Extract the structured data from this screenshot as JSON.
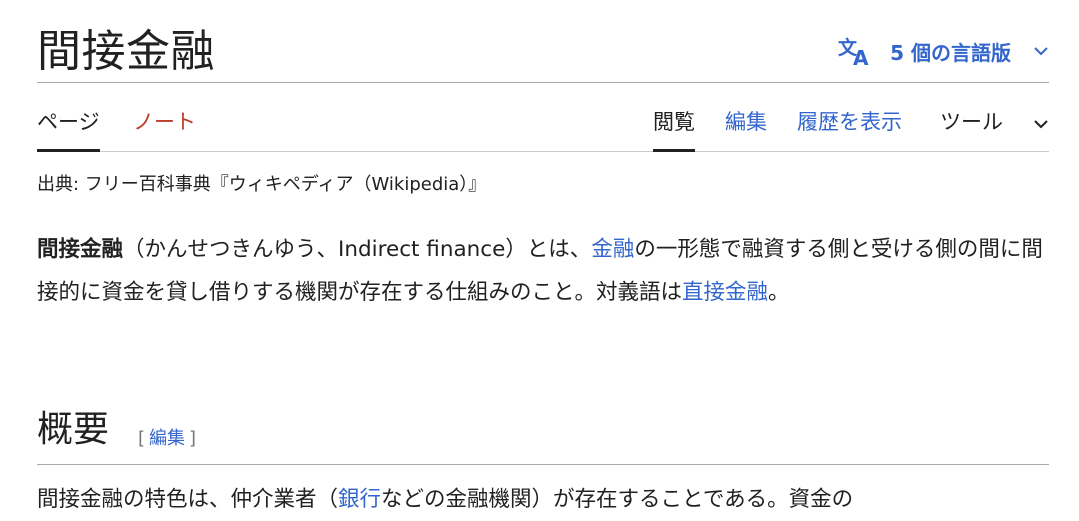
{
  "article": {
    "title": "間接金融"
  },
  "language_button": {
    "label": "5 個の言語版",
    "icon": "translate-icon",
    "chevron": "chevron-down-icon",
    "color": "#3366cc"
  },
  "tabs": {
    "page": "ページ",
    "talk": "ノート",
    "read": "閲覧",
    "edit": "編集",
    "history": "履歴を表示",
    "tools": "ツール"
  },
  "from_line": "出典: フリー百科事典『ウィキペディア（Wikipedia）』",
  "intro": {
    "term": "間接金融",
    "text1": "（かんせつきんゆう、Indirect finance）とは、",
    "link1": "金融",
    "text2": "の一形態で融資する側と受ける側の間に間接的に資金を貸し借りする機関が存在する仕組みのこと。対義語は",
    "link2": "直接金融",
    "text3": "。"
  },
  "section": {
    "title": "概要",
    "edit_open": "[",
    "edit_label": "編集",
    "edit_close": "]"
  },
  "overview": {
    "text1": "間接金融の特色は、仲介業者（",
    "link1": "銀行",
    "text2": "などの金融機関）が存在することである。資金の"
  },
  "colors": {
    "link": "#3366cc",
    "talk_link_red": "#bf3c2c",
    "text": "#202122"
  }
}
